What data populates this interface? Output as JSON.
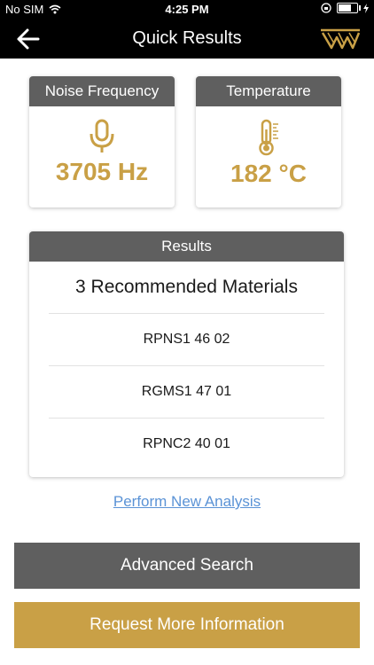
{
  "status_bar": {
    "carrier": "No SIM",
    "time": "4:25 PM"
  },
  "nav": {
    "title": "Quick Results"
  },
  "colors": {
    "accent": "#c9a046",
    "header_gray": "#5f5f5f",
    "link": "#5b93d6",
    "button_gray": "#5f5f5f",
    "nav_bg": "#000000"
  },
  "metrics": [
    {
      "title": "Noise Frequency",
      "icon": "microphone-icon",
      "value": "3705 Hz"
    },
    {
      "title": "Temperature",
      "icon": "thermometer-icon",
      "value": "182 °C"
    }
  ],
  "results": {
    "header": "Results",
    "summary": "3 Recommended Materials",
    "items": [
      "RPNS1 46 02",
      "RGMS1 47 01",
      "RPNC2 40 01"
    ]
  },
  "actions": {
    "new_analysis": "Perform New Analysis",
    "advanced_search": "Advanced Search",
    "request_info": "Request More Information"
  }
}
